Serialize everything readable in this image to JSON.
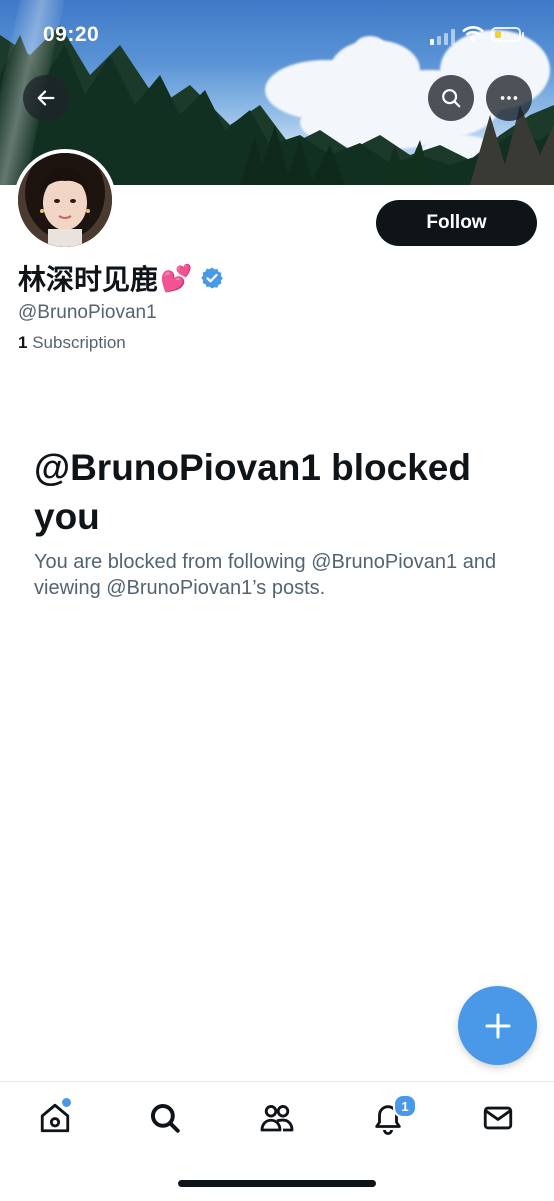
{
  "status_bar": {
    "time": "09:20"
  },
  "header": {
    "back_icon": "arrow-left-icon",
    "search_icon": "search-icon",
    "more_icon": "more-horizontal-icon"
  },
  "profile": {
    "display_name": "林深时见鹿",
    "name_emoji": "💕",
    "handle": "@BrunoPiovan1",
    "subscription_count": "1",
    "subscription_label": "Subscription",
    "follow_label": "Follow",
    "verified": true,
    "verified_color": "#4a99e9"
  },
  "blocked": {
    "title": "@BrunoPiovan1 blocked you",
    "description": "You are blocked from following @BrunoPiovan1 and viewing @BrunoPiovan1’s posts."
  },
  "fab": {
    "icon": "plus-icon",
    "color": "#4a99e9"
  },
  "tab_bar": {
    "items": [
      {
        "name": "home",
        "icon": "home-icon",
        "has_dot": true
      },
      {
        "name": "search",
        "icon": "search-icon"
      },
      {
        "name": "communities",
        "icon": "people-icon"
      },
      {
        "name": "notifications",
        "icon": "bell-icon",
        "badge": "1"
      },
      {
        "name": "messages",
        "icon": "mail-icon"
      }
    ]
  }
}
